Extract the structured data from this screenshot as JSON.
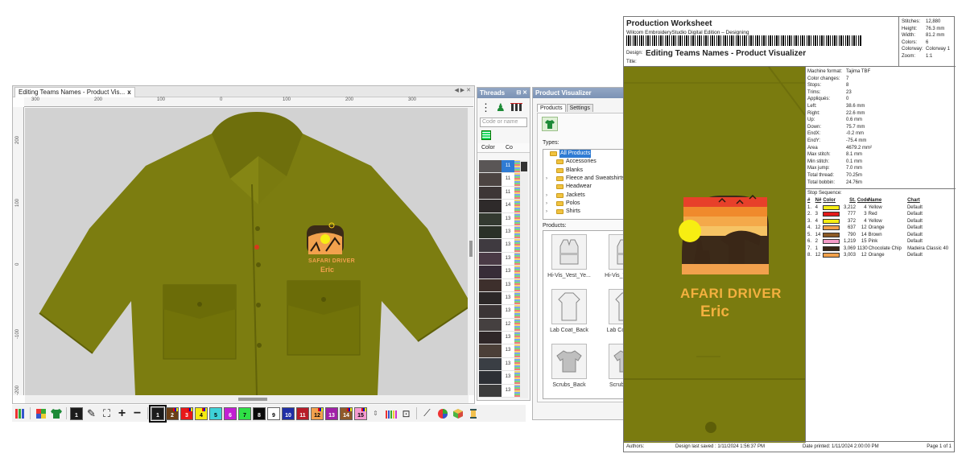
{
  "design_window": {
    "tab_title": "Editing Teams Names - Product Vis...",
    "tab_close": "x",
    "ruler_top_ticks": [
      "300",
      "200",
      "100",
      "0",
      "100",
      "200",
      "300"
    ],
    "ruler_left_ticks": [
      "200",
      "100",
      "0",
      "-100",
      "-200"
    ],
    "embroidery": {
      "line1": "SAFARI DRIVER",
      "line2": "Eric"
    }
  },
  "threads_panel": {
    "title": "Threads",
    "search_placeholder": "Code or name",
    "col_color": "Color",
    "col_code": "Co",
    "rows": [
      {
        "code": "11",
        "color": "#5a5656",
        "active": true
      },
      {
        "code": "11",
        "color": "#4c4442"
      },
      {
        "code": "11",
        "color": "#3d3636"
      },
      {
        "code": "14",
        "color": "#2e2a2a"
      },
      {
        "code": "13",
        "color": "#343a31"
      },
      {
        "code": "13",
        "color": "#2b3128"
      },
      {
        "code": "13",
        "color": "#3f3a40"
      },
      {
        "code": "13",
        "color": "#4a3a46"
      },
      {
        "code": "13",
        "color": "#372c38"
      },
      {
        "code": "13",
        "color": "#3d2f2c"
      },
      {
        "code": "13",
        "color": "#2c2828"
      },
      {
        "code": "13",
        "color": "#3b3536"
      },
      {
        "code": "12",
        "color": "#454040"
      },
      {
        "code": "13",
        "color": "#2f2728"
      },
      {
        "code": "13",
        "color": "#4b3f38"
      },
      {
        "code": "13",
        "color": "#3a3e44"
      },
      {
        "code": "13",
        "color": "#2d3035"
      },
      {
        "code": "13",
        "color": "#3c3c3c"
      }
    ]
  },
  "product_visualizer": {
    "title": "Product Visualizer",
    "tab_products": "Products",
    "tab_settings": "Settings",
    "types_label": "Types:",
    "products_label": "Products:",
    "types": [
      {
        "label": "All Products",
        "expander": "",
        "selected": true,
        "root": true
      },
      {
        "label": "Accessories",
        "expander": ""
      },
      {
        "label": "Blanks",
        "expander": ""
      },
      {
        "label": "Fleece and Sweatshirts",
        "expander": "›"
      },
      {
        "label": "Headwear",
        "expander": ""
      },
      {
        "label": "Jackets",
        "expander": "›"
      },
      {
        "label": "Polos",
        "expander": "›"
      },
      {
        "label": "Shirts",
        "expander": "›"
      }
    ],
    "products": [
      {
        "label": "Hi-Vis_Vest_Ye...",
        "icon": "vest-icon"
      },
      {
        "label": "Hi-Vis_Vest_Ye...",
        "icon": "vest-icon"
      },
      {
        "label": "Lab Coat_Back",
        "icon": "labcoat-icon"
      },
      {
        "label": "Lab Coat_Front",
        "icon": "labcoat-icon"
      },
      {
        "label": "Scrubs_Back",
        "icon": "tshirt-icon"
      },
      {
        "label": "Scrubs_Front",
        "icon": "tshirt-icon"
      }
    ]
  },
  "toolbar": {
    "swatches": [
      {
        "num": "1",
        "color": "#1b1b1b",
        "text": "#ffffff",
        "selected": true
      },
      {
        "num": "2",
        "color": "#6b3f17",
        "text": "#ffffff"
      },
      {
        "num": "3",
        "color": "#e81919",
        "text": "#ffffff"
      },
      {
        "num": "4",
        "color": "#f5ea13",
        "text": "#000000"
      },
      {
        "num": "5",
        "color": "#3ed2d8",
        "text": "#000000"
      },
      {
        "num": "6",
        "color": "#c21fd3",
        "text": "#ffffff"
      },
      {
        "num": "7",
        "color": "#2fe046",
        "text": "#000000"
      },
      {
        "num": "8",
        "color": "#0b0b0b",
        "text": "#ffffff"
      },
      {
        "num": "9",
        "color": "#ffffff",
        "text": "#000000"
      },
      {
        "num": "10",
        "color": "#1f2fa6",
        "text": "#ffffff"
      },
      {
        "num": "11",
        "color": "#b81c28",
        "text": "#ffffff"
      },
      {
        "num": "12",
        "color": "#f2a14d",
        "text": "#000000"
      },
      {
        "num": "13",
        "color": "#a121a8",
        "text": "#ffffff"
      },
      {
        "num": "14",
        "color": "#8f5a2a",
        "text": "#ffffff"
      },
      {
        "num": "15",
        "color": "#f59bd0",
        "text": "#000000"
      }
    ]
  },
  "worksheet": {
    "title": "Production Worksheet",
    "subtitle": "Wilcom EmbroideryStudio Digital Edition – Designing",
    "design_label": "Design:",
    "design_name": "Editing Teams Names - Product Visualizer",
    "title_label": "Title:",
    "stats": [
      {
        "k": "Stitches:",
        "v": "12,880"
      },
      {
        "k": "Height:",
        "v": "76.3 mm"
      },
      {
        "k": "Width:",
        "v": "81.2 mm"
      },
      {
        "k": "Colors:",
        "v": "6"
      },
      {
        "k": "Colorway:",
        "v": "Colorway 1"
      },
      {
        "k": "Zoom:",
        "v": "1:1"
      }
    ],
    "params": [
      {
        "k": "Machine format:",
        "v": "Tajima TBF"
      },
      {
        "k": "Color changes:",
        "v": "7"
      },
      {
        "k": "Stops:",
        "v": "8"
      },
      {
        "k": "Trims:",
        "v": "23"
      },
      {
        "k": "Appliqués:",
        "v": "0"
      },
      {
        "k": "Left:",
        "v": "38.6 mm"
      },
      {
        "k": "Right:",
        "v": "22.6 mm"
      },
      {
        "k": "Up:",
        "v": "0.6 mm"
      },
      {
        "k": "Down:",
        "v": "75.7 mm"
      },
      {
        "k": "EndX:",
        "v": "-0.2 mm"
      },
      {
        "k": "EndY:",
        "v": "-75.4 mm"
      },
      {
        "k": "Area",
        "v": "4679.2 mm²"
      },
      {
        "k": "Max stitch:",
        "v": "8.1 mm"
      },
      {
        "k": "Min stitch:",
        "v": "0.1 mm"
      },
      {
        "k": "Max jump:",
        "v": "7.0 mm"
      },
      {
        "k": "Total thread:",
        "v": "70.25m"
      },
      {
        "k": "Total bobbin:",
        "v": "24.76m"
      }
    ],
    "seq_title": "Stop Sequence:",
    "seq_head": {
      "a": "#",
      "b": "N#",
      "color": "Color",
      "st": "St.",
      "code": "Code",
      "name": "Name",
      "chart": "Chart"
    },
    "seq": [
      {
        "a": "1.",
        "b": "4",
        "color": "#f7ee12",
        "st": "3,212",
        "code": "4",
        "name": "Yellow",
        "chart": "Default"
      },
      {
        "a": "2.",
        "b": "3",
        "color": "#e31a1a",
        "st": "777",
        "code": "3",
        "name": "Red",
        "chart": "Default"
      },
      {
        "a": "3.",
        "b": "4",
        "color": "#f7ee12",
        "st": "372",
        "code": "4",
        "name": "Yellow",
        "chart": "Default"
      },
      {
        "a": "4.",
        "b": "12",
        "color": "#f1a14b",
        "st": "637",
        "code": "12",
        "name": "Orange",
        "chart": "Default"
      },
      {
        "a": "5.",
        "b": "14",
        "color": "#8c5a26",
        "st": "790",
        "code": "14",
        "name": "Brown",
        "chart": "Default"
      },
      {
        "a": "6.",
        "b": "2",
        "color": "#f59cc9",
        "st": "1,219",
        "code": "15",
        "name": "Pink",
        "chart": "Default"
      },
      {
        "a": "7.",
        "b": "1",
        "color": "#3a2717",
        "st": "3,069",
        "code": "1130",
        "name": "Chocolate Chip",
        "chart": "Madeira Classic 40"
      },
      {
        "a": "8.",
        "b": "12",
        "color": "#f1a14b",
        "st": "3,003",
        "code": "12",
        "name": "Orange",
        "chart": "Default"
      }
    ],
    "photo_text1": "AFARI DRIVER",
    "photo_text2": "Eric",
    "footer": {
      "authors": "Authors:",
      "saved": "Design last saved : 1/11/2024 1:56:37 PM",
      "printed": "Date printed: 1/11/2024 2:00:00 PM",
      "page": "Page 1 of 1"
    }
  }
}
